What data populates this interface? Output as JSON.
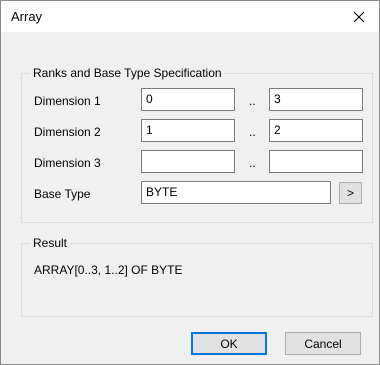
{
  "window": {
    "title": "Array",
    "close_glyph": "✕"
  },
  "spec_group": {
    "legend": "Ranks and Base Type Specification",
    "rows": [
      {
        "label": "Dimension 1",
        "lower": "0",
        "upper": "3",
        "separator": ".."
      },
      {
        "label": "Dimension 2",
        "lower": "1",
        "upper": "2",
        "separator": ".."
      },
      {
        "label": "Dimension 3",
        "lower": "",
        "upper": "",
        "separator": ".."
      }
    ],
    "base_type": {
      "label": "Base Type",
      "value": "BYTE",
      "browse_label": ">"
    }
  },
  "result_group": {
    "legend": "Result",
    "text": "ARRAY[0..3, 1..2] OF BYTE"
  },
  "buttons": {
    "ok": "OK",
    "cancel": "Cancel"
  }
}
